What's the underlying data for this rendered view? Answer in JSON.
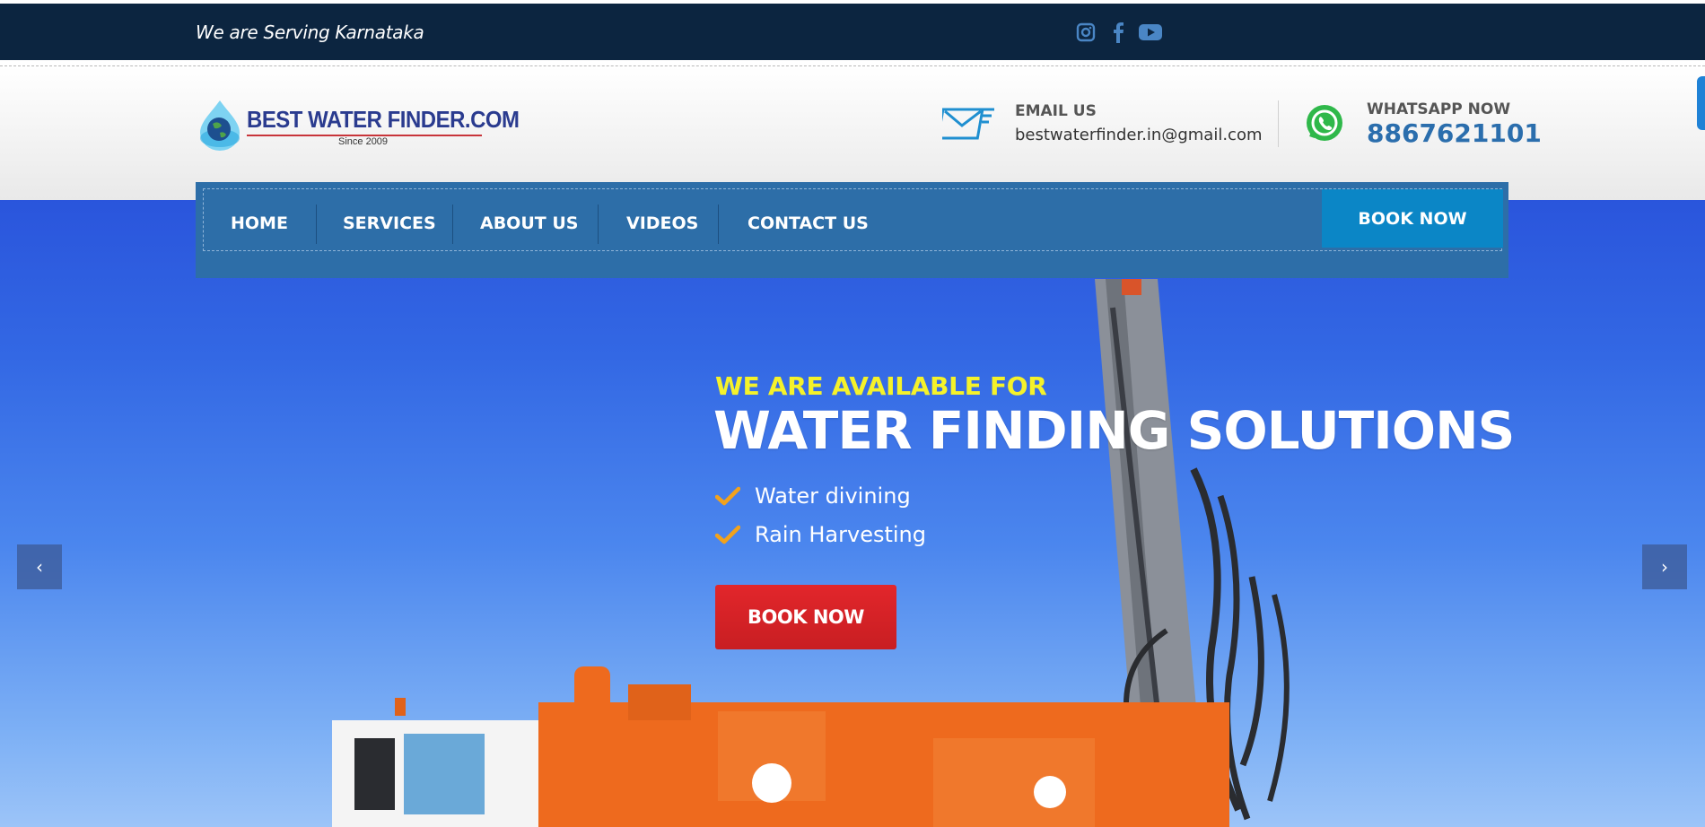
{
  "topbar": {
    "tagline": "We are Serving Karnataka",
    "social": [
      {
        "icon": "instagram-icon"
      },
      {
        "icon": "facebook-icon"
      },
      {
        "icon": "youtube-icon"
      }
    ]
  },
  "header": {
    "logo": {
      "name": "BEST WATER FINDER.COM",
      "since": "Since 2009"
    },
    "email": {
      "label": "EMAIL US",
      "value": "bestwaterfinder.in@gmail.com",
      "icon": "envelope-icon"
    },
    "whatsapp": {
      "label": "WHATSAPP NOW",
      "number": "8867621101",
      "icon": "whatsapp-icon"
    }
  },
  "nav": {
    "items": [
      {
        "label": "HOME"
      },
      {
        "label": "SERVICES"
      },
      {
        "label": "ABOUT US"
      },
      {
        "label": "VIDEOS"
      },
      {
        "label": "CONTACT US"
      }
    ],
    "book_label": "BOOK NOW"
  },
  "hero": {
    "kicker": "WE ARE AVAILABLE FOR",
    "title": "WATER FINDING SOLUTIONS",
    "features": [
      "Water divining",
      "Rain Harvesting"
    ],
    "cta": "BOOK NOW",
    "prev_icon": "chevron-left-icon",
    "next_icon": "chevron-right-icon",
    "prev_symbol": "‹",
    "next_symbol": "›"
  },
  "colors": {
    "topbar": "#0c2540",
    "nav": "#2d6ea8",
    "accent_blue": "#0b86c6",
    "cta_red": "#d62226",
    "kicker_yellow": "#f5f22a",
    "check_orange": "#f2a21c"
  }
}
